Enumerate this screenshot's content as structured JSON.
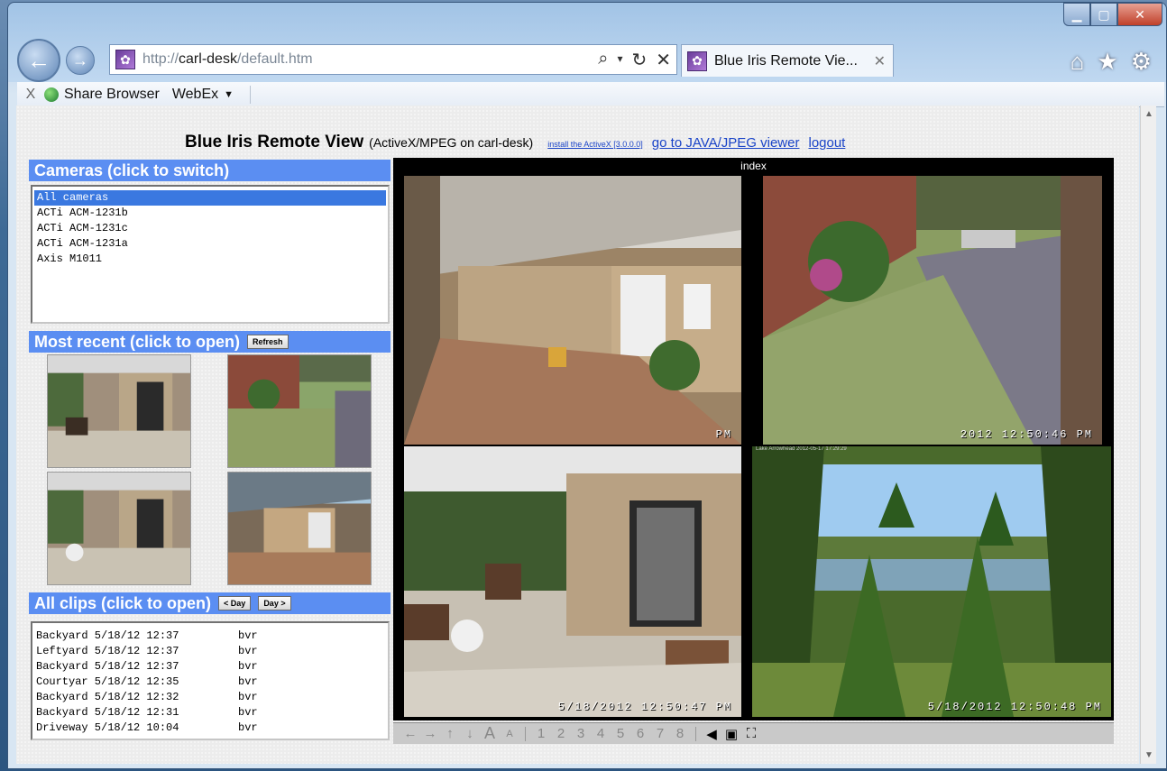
{
  "browser": {
    "address_url_prefix": "http://",
    "address_host": "carl-desk",
    "address_path": "/default.htm",
    "tab_title": "Blue Iris Remote Vie...",
    "toolbar": {
      "close_label": "X",
      "share_browser_label": "Share Browser",
      "webex_label": "WebEx"
    }
  },
  "page": {
    "title": "Blue Iris Remote View",
    "subtitle": "(ActiveX/MPEG on carl-desk)",
    "install_link": "install the ActiveX [3.0.0.0]",
    "java_link": "go to JAVA/JPEG viewer",
    "logout_link": "logout"
  },
  "cameras_panel": {
    "header": "Cameras (click to switch)",
    "items": [
      "All cameras",
      "ACTi ACM-1231b",
      "ACTi ACM-1231c",
      "ACTi ACM-1231a",
      "Axis M1011"
    ],
    "selected_index": 0
  },
  "recent_panel": {
    "header": "Most recent (click to open)",
    "refresh_label": "Refresh"
  },
  "clips_panel": {
    "header": "All clips (click to open)",
    "prev_day_label": "< Day",
    "next_day_label": "Day >",
    "clips": [
      {
        "name": "Backyard 5/18/12 12:37",
        "ext": "bvr"
      },
      {
        "name": "Leftyard 5/18/12 12:37",
        "ext": "bvr"
      },
      {
        "name": "Backyard 5/18/12 12:37",
        "ext": "bvr"
      },
      {
        "name": "Courtyar 5/18/12 12:35",
        "ext": "bvr"
      },
      {
        "name": "Backyard 5/18/12 12:32",
        "ext": "bvr"
      },
      {
        "name": "Backyard 5/18/12 12:31",
        "ext": "bvr"
      },
      {
        "name": "Driveway 5/18/12 10:04",
        "ext": "bvr"
      }
    ]
  },
  "viewer": {
    "label": "index",
    "timestamps": {
      "top_left": "PM",
      "top_right": "2012 12:50:46 PM",
      "bottom_left": "5/18/2012 12:50:47 PM",
      "bottom_right": "5/18/2012 12:50:48 PM",
      "bottom_right_caption": "Lake Arrowhead 2012-05-17 17:29:29"
    },
    "controls": [
      "←",
      "→",
      "↑",
      "↓",
      "A",
      "A",
      "1",
      "2",
      "3",
      "4",
      "5",
      "6",
      "7",
      "8"
    ]
  },
  "colors": {
    "panel_header": "#5b8ef2",
    "link": "#1a44c8",
    "selection": "#3a78e0"
  }
}
